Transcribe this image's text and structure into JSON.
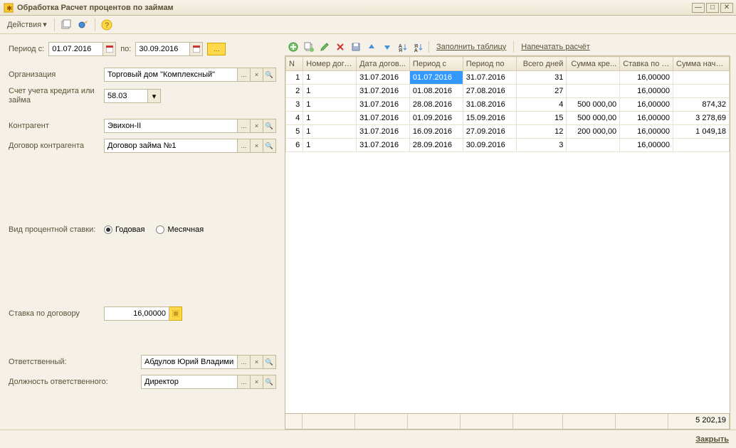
{
  "window": {
    "title": "Обработка  Расчет процентов по займам"
  },
  "topbar": {
    "actions": "Действия",
    "dropdown_glyph": "▾"
  },
  "period": {
    "label_from": "Период с:",
    "from": "01.07.2016",
    "label_to": "по:",
    "to": "30.09.2016"
  },
  "fields": {
    "org_label": "Организация",
    "org_value": "Торговый дом \"Комплексный\"",
    "account_label": "Счет учета кредита или займа",
    "account_value": "58.03",
    "counterparty_label": "Контрагент",
    "counterparty_value": "Эвихон-II",
    "contract_label": "Договор контрагента",
    "contract_value": "Договор займа №1",
    "rate_type_label": "Вид процентной ставки:",
    "rate_annual": "Годовая",
    "rate_monthly": "Месячная",
    "contract_rate_label": "Ставка по договору",
    "contract_rate_value": "16,00000",
    "responsible_label": "Ответственный:",
    "responsible_value": "Абдулов Юрий Владимирович",
    "position_label": "Должность ответственного:",
    "position_value": "Директор"
  },
  "grid_toolbar": {
    "fill": "Заполнить таблицу",
    "print": "Напечатать расчёт"
  },
  "grid": {
    "columns": [
      "N",
      "Номер дого...",
      "Дата догов...",
      "Период с",
      "Период по",
      "Всего дней",
      "Сумма кре...",
      "Ставка по д...",
      "Сумма начи..."
    ],
    "rows": [
      {
        "n": "1",
        "num": "1",
        "date": "31.07.2016",
        "from": "01.07.2016",
        "to": "31.07.2016",
        "days": "31",
        "credit": "",
        "rate": "16,00000",
        "accr": ""
      },
      {
        "n": "2",
        "num": "1",
        "date": "31.07.2016",
        "from": "01.08.2016",
        "to": "27.08.2016",
        "days": "27",
        "credit": "",
        "rate": "16,00000",
        "accr": ""
      },
      {
        "n": "3",
        "num": "1",
        "date": "31.07.2016",
        "from": "28.08.2016",
        "to": "31.08.2016",
        "days": "4",
        "credit": "500 000,00",
        "rate": "16,00000",
        "accr": "874,32"
      },
      {
        "n": "4",
        "num": "1",
        "date": "31.07.2016",
        "from": "01.09.2016",
        "to": "15.09.2016",
        "days": "15",
        "credit": "500 000,00",
        "rate": "16,00000",
        "accr": "3 278,69"
      },
      {
        "n": "5",
        "num": "1",
        "date": "31.07.2016",
        "from": "16.09.2016",
        "to": "27.09.2016",
        "days": "12",
        "credit": "200 000,00",
        "rate": "16,00000",
        "accr": "1 049,18"
      },
      {
        "n": "6",
        "num": "1",
        "date": "31.07.2016",
        "from": "28.09.2016",
        "to": "30.09.2016",
        "days": "3",
        "credit": "",
        "rate": "16,00000",
        "accr": ""
      }
    ],
    "footer_total": "5 202,19"
  },
  "bottom": {
    "close": "Закрыть"
  },
  "glyphs": {
    "ellipsis": "...",
    "search": "🔍",
    "calendar": "📅",
    "dropdown": "▾"
  }
}
